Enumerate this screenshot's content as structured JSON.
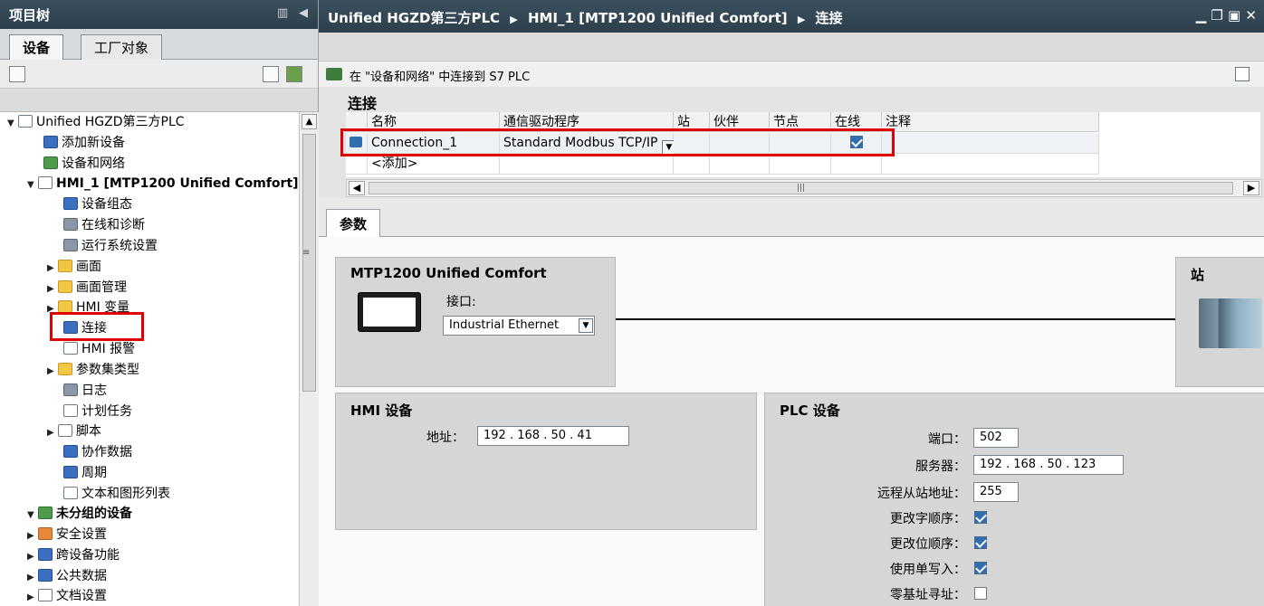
{
  "project_tree": {
    "title": "项目树",
    "tabs": [
      "设备",
      "工厂对象"
    ],
    "items": [
      {
        "label": "Unified HGZD第三方PLC",
        "icon": "project-icon"
      },
      {
        "label": "添加新设备",
        "icon": "add-device-icon"
      },
      {
        "label": "设备和网络",
        "icon": "network-icon"
      },
      {
        "label": "HMI_1 [MTP1200 Unified Comfort]",
        "icon": "hmi-device-icon"
      },
      {
        "label": "设备组态",
        "icon": "device-config-icon"
      },
      {
        "label": "在线和诊断",
        "icon": "online-diagnostics-icon"
      },
      {
        "label": "运行系统设置",
        "icon": "runtime-settings-icon"
      },
      {
        "label": "画面",
        "icon": "folder-icon"
      },
      {
        "label": "画面管理",
        "icon": "screen-management-icon"
      },
      {
        "label": "HMI 变量",
        "icon": "hmi-tags-icon"
      },
      {
        "label": "连接",
        "icon": "connection-icon"
      },
      {
        "label": "HMI 报警",
        "icon": "alarm-icon"
      },
      {
        "label": "参数集类型",
        "icon": "folder-icon"
      },
      {
        "label": "日志",
        "icon": "log-icon"
      },
      {
        "label": "计划任务",
        "icon": "scheduled-task-icon"
      },
      {
        "label": "脚本",
        "icon": "script-icon"
      },
      {
        "label": "协作数据",
        "icon": "collaboration-data-icon"
      },
      {
        "label": "周期",
        "icon": "cycle-icon"
      },
      {
        "label": "文本和图形列表",
        "icon": "text-graphic-list-icon"
      },
      {
        "label": "未分组的设备",
        "icon": "ungrouped-devices-icon"
      },
      {
        "label": "安全设置",
        "icon": "security-icon"
      },
      {
        "label": "跨设备功能",
        "icon": "cross-device-icon"
      },
      {
        "label": "公共数据",
        "icon": "common-data-icon"
      },
      {
        "label": "文档设置",
        "icon": "document-settings-icon"
      }
    ]
  },
  "editor": {
    "breadcrumb": [
      "Unified HGZD第三方PLC",
      "HMI_1 [MTP1200 Unified Comfort]",
      "连接"
    ],
    "toolbar_text": "在 \"设备和网络\" 中连接到 S7 PLC",
    "section_title": "连接",
    "columns": [
      "名称",
      "通信驱动程序",
      "站",
      "伙伴",
      "节点",
      "在线",
      "注释"
    ],
    "rows": [
      {
        "name": "Connection_1",
        "driver": "Standard Modbus TCP/IP",
        "online": true
      }
    ],
    "add_row": "<添加>"
  },
  "params": {
    "tab": "参数",
    "device_box_title": "MTP1200 Unified Comfort",
    "interface_label": "接口:",
    "interface_value": "Industrial Ethernet",
    "station_title": "站",
    "hmi_title": "HMI 设备",
    "hmi_address_label": "地址：",
    "hmi_address": [
      "192",
      "168",
      "50",
      "41"
    ],
    "plc_title": "PLC 设备",
    "port_label": "端口：",
    "port": "502",
    "server_label": "服务器：",
    "server": [
      "192",
      "168",
      "50",
      "123"
    ],
    "slave_label": "远程从站地址：",
    "slave": "255",
    "swap_word_label": "更改字顺序：",
    "swap_bit_label": "更改位顺序：",
    "single_write_label": "使用单写入：",
    "zero_based_label": "零基址寻址："
  },
  "checks": {
    "swap_word": true,
    "swap_bit": true,
    "single_write": true,
    "zero_based": false
  }
}
